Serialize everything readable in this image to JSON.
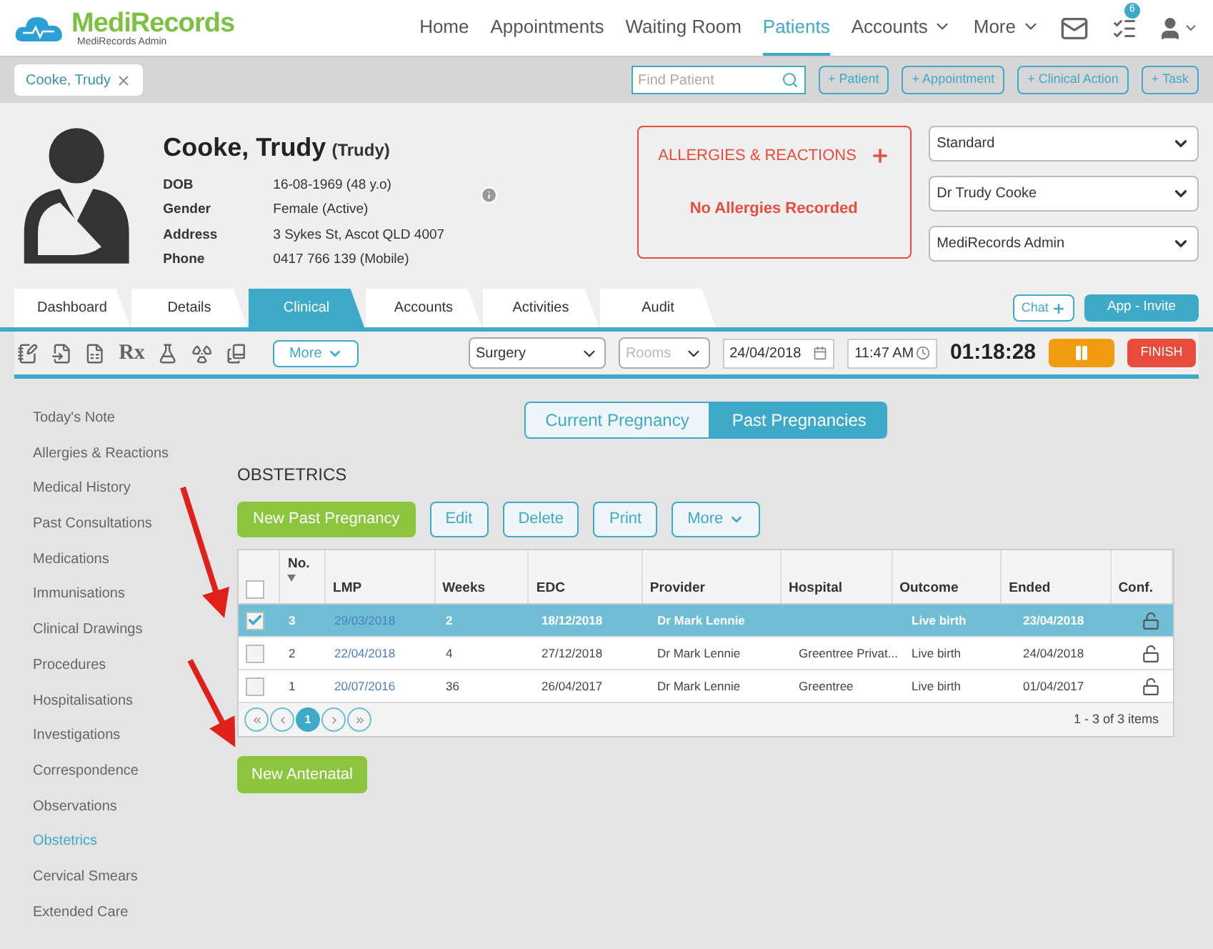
{
  "nav": {
    "logo": "MediRecords",
    "logo_subtitle": "MediRecords Admin",
    "items": [
      {
        "label": "Home",
        "selected": false,
        "dropdown": false
      },
      {
        "label": "Appointments",
        "selected": false,
        "dropdown": false
      },
      {
        "label": "Waiting Room",
        "selected": false,
        "dropdown": false
      },
      {
        "label": "Patients",
        "selected": true,
        "dropdown": false
      },
      {
        "label": "Accounts",
        "selected": false,
        "dropdown": true
      },
      {
        "label": "More",
        "selected": false,
        "dropdown": true
      }
    ],
    "task_count": "6"
  },
  "patient_bar": {
    "open_patient": "Cooke, Trudy",
    "search_placeholder": "Find Patient",
    "actions": [
      "+ Patient",
      "+ Appointment",
      "+ Clinical Action",
      "+ Task"
    ]
  },
  "patient": {
    "name": "Cooke, Trudy",
    "preferred_name": "(Trudy)",
    "details": [
      {
        "label": "DOB",
        "value": "16-08-1969 (48 y.o)"
      },
      {
        "label": "Gender",
        "value": "Female (Active)"
      },
      {
        "label": "Address",
        "value": "3 Sykes St, Ascot QLD 4007"
      },
      {
        "label": "Phone",
        "value": "0417 766 139 (Mobile)"
      }
    ],
    "allergies": {
      "title": "ALLERGIES & REACTIONS",
      "message": "No Allergies Recorded"
    },
    "selects": [
      "Standard",
      "Dr Trudy Cooke",
      "MediRecords Admin"
    ]
  },
  "tabs": [
    {
      "label": "Dashboard",
      "selected": false
    },
    {
      "label": "Details",
      "selected": false
    },
    {
      "label": "Clinical",
      "selected": true
    },
    {
      "label": "Accounts",
      "selected": false
    },
    {
      "label": "Activities",
      "selected": false
    },
    {
      "label": "Audit",
      "selected": false
    }
  ],
  "header_buttons": {
    "chat": "Chat",
    "invite": "App - Invite"
  },
  "toolbar": {
    "rx": "Rx",
    "more": "More",
    "location": "Surgery",
    "room_placeholder": "Rooms",
    "date": "24/04/2018",
    "time": "11:47 AM",
    "timer": "01:18:28",
    "finish": "FINISH"
  },
  "sidebar": {
    "items": [
      {
        "label": "Today's Note",
        "selected": false
      },
      {
        "label": "Allergies & Reactions",
        "selected": false
      },
      {
        "label": "Medical History",
        "selected": false
      },
      {
        "label": "Past Consultations",
        "selected": false
      },
      {
        "label": "Medications",
        "selected": false
      },
      {
        "label": "Immunisations",
        "selected": false
      },
      {
        "label": "Clinical Drawings",
        "selected": false
      },
      {
        "label": "Procedures",
        "selected": false
      },
      {
        "label": "Hospitalisations",
        "selected": false
      },
      {
        "label": "Investigations",
        "selected": false
      },
      {
        "label": "Correspondence",
        "selected": false
      },
      {
        "label": "Observations",
        "selected": false
      },
      {
        "label": "Obstetrics",
        "selected": true
      },
      {
        "label": "Cervical Smears",
        "selected": false
      },
      {
        "label": "Extended Care",
        "selected": false
      }
    ]
  },
  "pregnancy_toggle": [
    {
      "label": "Current Pregnancy",
      "selected": false
    },
    {
      "label": "Past Pregnancies",
      "selected": true
    }
  ],
  "section_title": "OBSTETRICS",
  "buttons": [
    {
      "label": "New Past Pregnancy",
      "kind": "primary"
    },
    {
      "label": "Edit",
      "kind": "secondary"
    },
    {
      "label": "Delete",
      "kind": "secondary"
    },
    {
      "label": "Print",
      "kind": "secondary"
    },
    {
      "label": "More",
      "kind": "dropdown"
    }
  ],
  "table": {
    "select_all_checked": false,
    "columns": [
      "No.",
      "LMP",
      "Weeks",
      "EDC",
      "Provider",
      "Hospital",
      "Outcome",
      "Ended",
      "Conf."
    ],
    "rows": [
      {
        "selected": true,
        "cells": [
          "3",
          "29/03/2018",
          "2",
          "18/12/2018",
          "Dr Mark Lennie",
          "",
          "Live birth",
          "23/04/2018"
        ]
      },
      {
        "selected": false,
        "cells": [
          "2",
          "22/04/2018",
          "4",
          "27/12/2018",
          "Dr Mark Lennie",
          "Greentree Privat...",
          "Live birth",
          "24/04/2018"
        ]
      },
      {
        "selected": false,
        "cells": [
          "1",
          "20/07/2016",
          "36",
          "26/04/2017",
          "Dr Mark Lennie",
          "Greentree",
          "Live birth",
          "01/04/2017"
        ]
      }
    ],
    "page": "1",
    "summary": "1 - 3 of 3 items"
  },
  "new_antenatal": "New Antenatal"
}
